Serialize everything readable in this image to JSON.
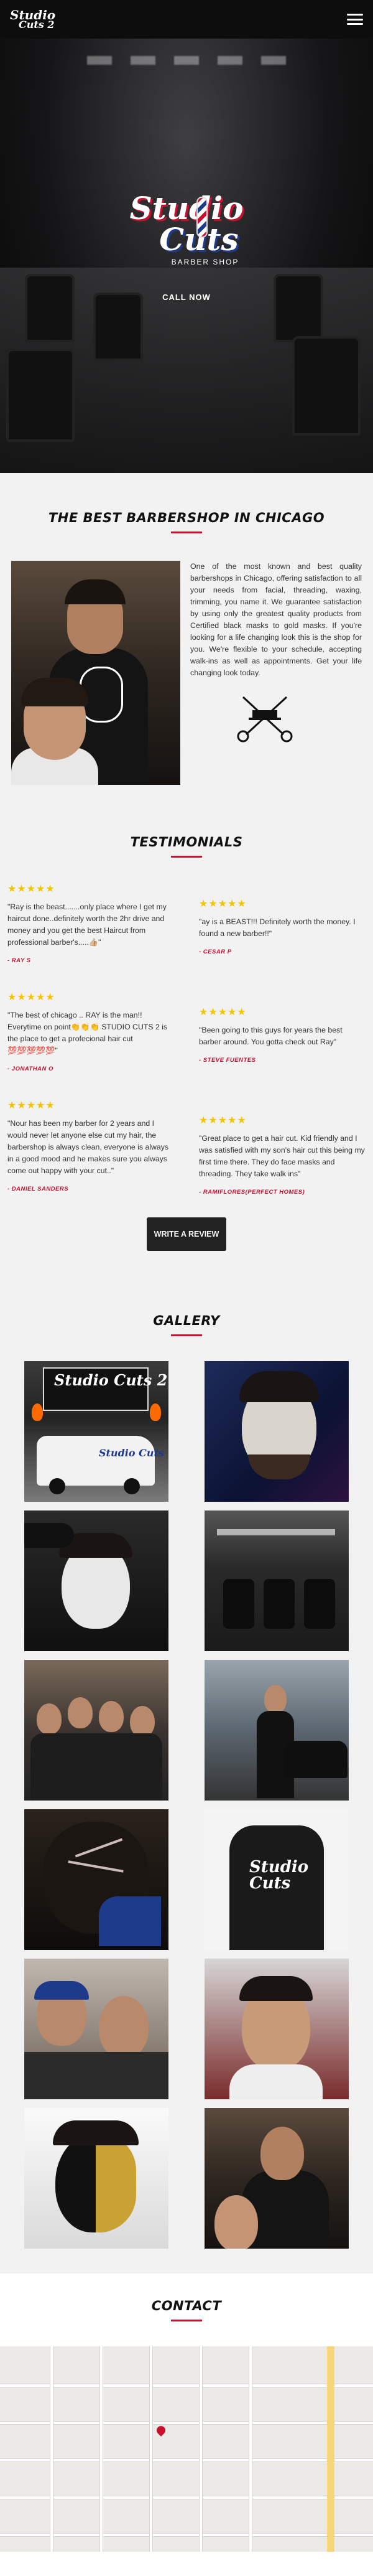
{
  "header": {
    "logo_line1": "Studio",
    "logo_line2": "Cuts 2",
    "menu_icon": "hamburger-icon"
  },
  "hero": {
    "logo_line1": "Studio",
    "logo_line2": "Cuts",
    "logo_sub": "BARBER SHOP",
    "cta_label": "CALL NOW"
  },
  "about": {
    "title": "The Best Barbershop in Chicago",
    "text": "One of the most known and best quality barbershops in Chicago, offering satisfaction to all your needs from facial, threading, waxing, trimming, you name it. We guarantee satisfaction by using only the greatest quality products from Certified black masks to gold masks. If you're looking for a life changing look this is the shop for you. We're flexible to your schedule, accepting walk-ins as well as appointments. Get your life changing look today.",
    "icon": "razor-scissors-icon"
  },
  "testimonials": {
    "title": "Testimonials",
    "stars": "★★★★★",
    "items": [
      {
        "text": "\"Ray is the beast.......only place where I get my haircut done..definitely worth the 2hr drive and money and you get the best Haircut from professional barber's.....👍🏼\"",
        "author": "- Ray S"
      },
      {
        "text": "\"ay is a BEAST!!! Definitely worth the money. I found a new barber!!\"",
        "author": "- Cesar P"
      },
      {
        "text": "\"The best of chicago .. RAY is the man!! Everytime on point👏👏👏 STUDIO CUTS 2 is the place to get a profecional hair cut 💯💯💯💯💯\"",
        "author": "- Jonathan O"
      },
      {
        "text": "\"Been going to this guys for years the best barber around. You gotta check out Ray\"",
        "author": "- Steve Fuentes"
      },
      {
        "text": "\"Nour has been my barber for 2 years and I would never let anyone else cut my hair, the barbershop is always clean, everyone is always in a good mood and he makes sure you always come out happy with your cut..\"",
        "author": "- Daniel Sanders"
      },
      {
        "text": "\"Great place to get a hair cut. Kid friendly and I was satisfied with my son's hair cut this being my first time there. They do face masks and threading. They take walk ins\"",
        "author": "- Ramiflores(Perfect Homes)"
      }
    ],
    "button_label": "Write a review"
  },
  "gallery": {
    "title": "Gallery",
    "photo1_sign": "Studio Cuts 2",
    "photo1_van": "Studio Cuts",
    "photo5_shirt": "Studio Cuts"
  },
  "contact": {
    "title": "Contact"
  },
  "colors": {
    "accent": "#c8102e",
    "stars": "#f5c400",
    "dark": "#0d0d0d"
  }
}
